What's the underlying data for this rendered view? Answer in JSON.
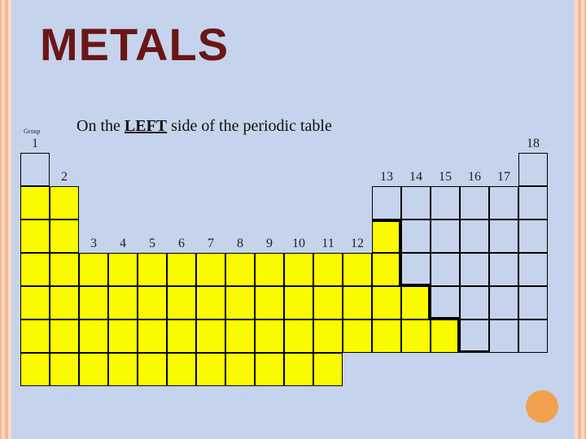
{
  "title": "METALS",
  "group_label": "Group",
  "subtitle_pre": "On the ",
  "subtitle_bold": "LEFT",
  "subtitle_post": " side of the periodic table",
  "groups": {
    "g1": "1",
    "g2": "2",
    "g3": "3",
    "g4": "4",
    "g5": "5",
    "g6": "6",
    "g7": "7",
    "g8": "8",
    "g9": "9",
    "g10": "10",
    "g11": "11",
    "g12": "12",
    "g13": "13",
    "g14": "14",
    "g15": "15",
    "g16": "16",
    "g17": "17",
    "g18": "18"
  },
  "chart_data": {
    "type": "table",
    "title": "Periodic table metals highlighted",
    "legend": {
      "metal": "#fbfb00",
      "nonmetal": "#c6d3ec"
    },
    "grid_note": "rows 1-7 x groups 1-18; value 1=cell shown metal (yellow), 0=cell shown non-metal, null=no cell drawn",
    "rows": [
      {
        "period": 1,
        "cells": [
          0,
          null,
          null,
          null,
          null,
          null,
          null,
          null,
          null,
          null,
          null,
          null,
          null,
          null,
          null,
          null,
          null,
          0
        ]
      },
      {
        "period": 2,
        "cells": [
          1,
          1,
          null,
          null,
          null,
          null,
          null,
          null,
          null,
          null,
          null,
          null,
          0,
          0,
          0,
          0,
          0,
          0
        ]
      },
      {
        "period": 3,
        "cells": [
          1,
          1,
          null,
          null,
          null,
          null,
          null,
          null,
          null,
          null,
          null,
          null,
          1,
          0,
          0,
          0,
          0,
          0
        ]
      },
      {
        "period": 4,
        "cells": [
          1,
          1,
          1,
          1,
          1,
          1,
          1,
          1,
          1,
          1,
          1,
          1,
          1,
          0,
          0,
          0,
          0,
          0
        ]
      },
      {
        "period": 5,
        "cells": [
          1,
          1,
          1,
          1,
          1,
          1,
          1,
          1,
          1,
          1,
          1,
          1,
          1,
          1,
          0,
          0,
          0,
          0
        ]
      },
      {
        "period": 6,
        "cells": [
          1,
          1,
          1,
          1,
          1,
          1,
          1,
          1,
          1,
          1,
          1,
          1,
          1,
          1,
          1,
          0,
          0,
          0
        ]
      },
      {
        "period": 7,
        "cells": [
          1,
          1,
          1,
          1,
          1,
          1,
          1,
          1,
          1,
          1,
          1,
          null,
          null,
          null,
          null,
          null,
          null,
          null
        ]
      }
    ]
  }
}
